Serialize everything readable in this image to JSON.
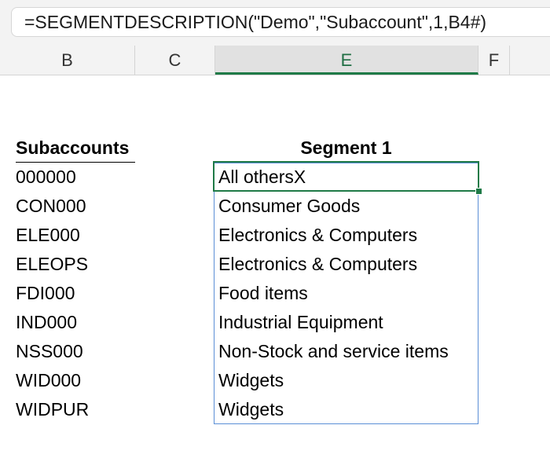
{
  "formula_bar": {
    "formula": "=SEGMENTDESCRIPTION(\"Demo\",\"Subaccount\",1,B4#)"
  },
  "columns": [
    {
      "label": "B"
    },
    {
      "label": "C"
    },
    {
      "label": "E"
    },
    {
      "label": "F"
    }
  ],
  "table": {
    "sub_header": "Subaccounts",
    "seg_header": "Segment 1",
    "subaccounts": [
      "000000",
      "CON000",
      "ELE000",
      "ELEOPS",
      "FDI000",
      "IND000",
      "NSS000",
      "WID000",
      "WIDPUR"
    ],
    "segments": [
      "All othersX",
      "Consumer Goods",
      "Electronics & Computers",
      "Electronics & Computers",
      "Food items",
      "Industrial Equipment",
      "Non-Stock and service items",
      "Widgets",
      "Widgets"
    ]
  },
  "colors": {
    "selection": "#1f7a47",
    "spill": "#5b8fd6"
  }
}
